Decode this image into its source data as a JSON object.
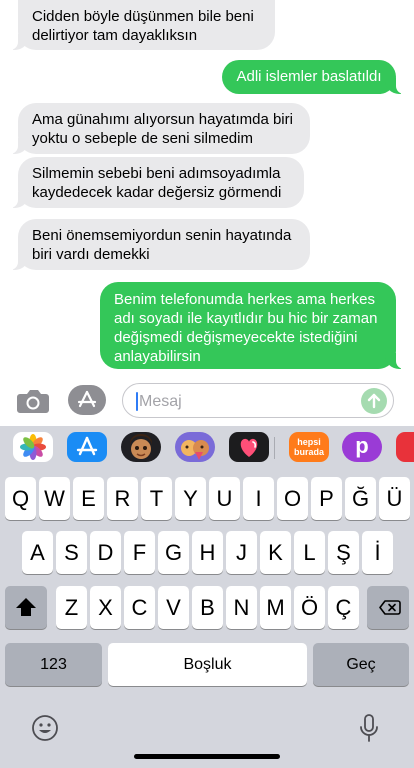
{
  "conversation": {
    "messages": [
      {
        "direction": "in",
        "text": "Cidden böyle düşünmen bile beni delirtiyor tam dayaklıksın"
      },
      {
        "direction": "out",
        "text": "Adli islemler baslatıldı"
      },
      {
        "direction": "in",
        "text": "Ama günahımı alıyorsun hayatımda biri yoktu o sebeple de seni silmedim"
      },
      {
        "direction": "in",
        "text": "Silmemin sebebi beni adımsoyadımla kaydedecek kadar değersiz görmendi"
      },
      {
        "direction": "in",
        "text": "Beni önemsemiyordun senin hayatında biri vardı demekki"
      },
      {
        "direction": "out",
        "text": "Benim telefonumda herkes ama herkes adı soyadı ile kayıtlıdır bu hic bir zaman değişmedi değişmeyecekte istediğini anlayabilirsin"
      }
    ]
  },
  "input_bar": {
    "placeholder": "Mesaj",
    "camera_icon": "camera-icon",
    "apps_icon": "app-store-icon",
    "send_icon": "arrow-up-icon"
  },
  "app_strip": {
    "apps": [
      {
        "name": "photos",
        "icon": "photos-icon"
      },
      {
        "name": "app-store",
        "icon": "app-store-icon"
      },
      {
        "name": "memoji-1",
        "icon": "memoji-icon"
      },
      {
        "name": "memoji-2",
        "icon": "memoji-stickers-icon"
      },
      {
        "name": "digital-touch",
        "icon": "heart-icon"
      },
      {
        "name": "hepsiburada",
        "label_top": "hepsi",
        "label_bottom": "burada"
      },
      {
        "name": "picsart",
        "letter": "p"
      },
      {
        "name": "partial-red-app",
        "icon": "app-icon"
      }
    ]
  },
  "keyboard": {
    "row1": [
      "Q",
      "W",
      "E",
      "R",
      "T",
      "Y",
      "U",
      "I",
      "O",
      "P",
      "Ğ",
      "Ü"
    ],
    "row2": [
      "A",
      "S",
      "D",
      "F",
      "G",
      "H",
      "J",
      "K",
      "L",
      "Ş",
      "İ"
    ],
    "row3": [
      "Z",
      "X",
      "C",
      "V",
      "B",
      "N",
      "M",
      "Ö",
      "Ç"
    ],
    "shift_icon": "shift-icon",
    "delete_icon": "delete-icon",
    "numbers_label": "123",
    "space_label": "Boşluk",
    "return_label": "Geç",
    "emoji_icon": "emoji-icon",
    "mic_icon": "microphone-icon"
  },
  "colors": {
    "incoming_bubble": "#e9e9eb",
    "outgoing_bubble": "#34c759",
    "keyboard_bg": "#d4d6dd",
    "send_disabled": "#a5dbb0"
  }
}
